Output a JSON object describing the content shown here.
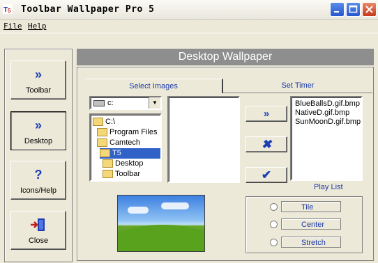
{
  "window": {
    "title": "Toolbar Wallpaper Pro 5"
  },
  "menu": {
    "file": "File",
    "help": "Help"
  },
  "nav": [
    {
      "label": "Toolbar",
      "icon": "double-chevron-icon"
    },
    {
      "label": "Desktop",
      "icon": "double-chevron-icon"
    },
    {
      "label": "Icons/Help",
      "icon": "question-icon"
    },
    {
      "label": "Close",
      "icon": "exit-door-icon"
    }
  ],
  "main": {
    "heading": "Desktop Wallpaper",
    "tabs": [
      "Select Images",
      "Set Timer"
    ],
    "drive": "c:",
    "tree": [
      "C:\\",
      "Program Files",
      "Camtech",
      "T5",
      "Desktop",
      "Toolbar"
    ],
    "tree_selected": "T5",
    "playlist": [
      "BlueBallsD.gif.bmp",
      "NativeD.gif.bmp",
      "SunMoonD.gif.bmp"
    ],
    "playlist_label": "Play List",
    "actions": [
      "add-icon",
      "remove-icon",
      "apply-icon"
    ],
    "placement_options": [
      "Tile",
      "Center",
      "Stretch"
    ]
  },
  "colors": {
    "heading_bg": "#8e8e8e",
    "accent_text": "#1e3aa8",
    "selection": "#3162c8"
  }
}
